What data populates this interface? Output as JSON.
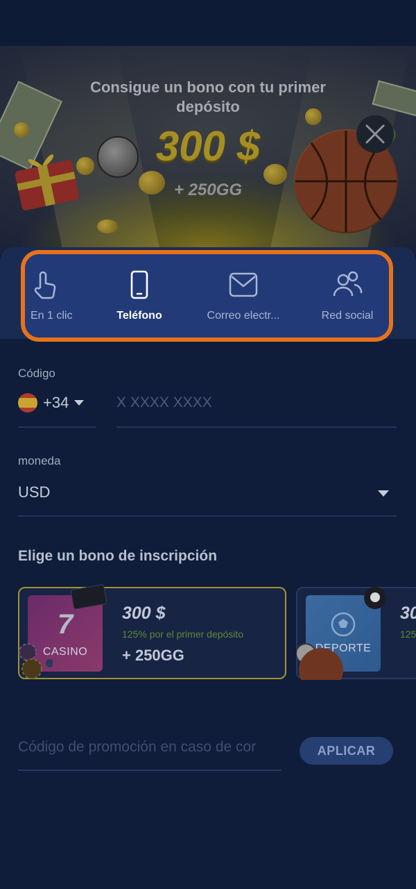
{
  "banner": {
    "title": "Consigue un bono con tu primer depósito",
    "amount": "300 $",
    "extra": "+ 250GG"
  },
  "tabs": [
    {
      "label": "En 1 clic",
      "icon": "hand-pointer-icon"
    },
    {
      "label": "Teléfono",
      "icon": "phone-icon",
      "active": true
    },
    {
      "label": "Correo electr...",
      "icon": "envelope-icon"
    },
    {
      "label": "Red social",
      "icon": "users-icon"
    }
  ],
  "form": {
    "code_label": "Código",
    "country_code": "+34",
    "phone_placeholder": "X XXXX XXXX",
    "currency_label": "moneda",
    "currency_value": "USD"
  },
  "bonus": {
    "section_title": "Elige un bono de inscripción",
    "cards": [
      {
        "category": "CASINO",
        "amount": "300 $",
        "desc": "125% por el primer depósito",
        "extra": "+ 250GG",
        "selected": true
      },
      {
        "category": "DEPORTE",
        "amount": "30",
        "desc": "125",
        "selected": false
      }
    ]
  },
  "promo": {
    "placeholder": "Código de promoción en caso de cor",
    "apply_label": "APLICAR"
  },
  "colors": {
    "background": "#0f1c3a",
    "highlight_border": "#e8721c",
    "tabs_bg": "#233a78",
    "selected_card_border": "#a39331"
  }
}
